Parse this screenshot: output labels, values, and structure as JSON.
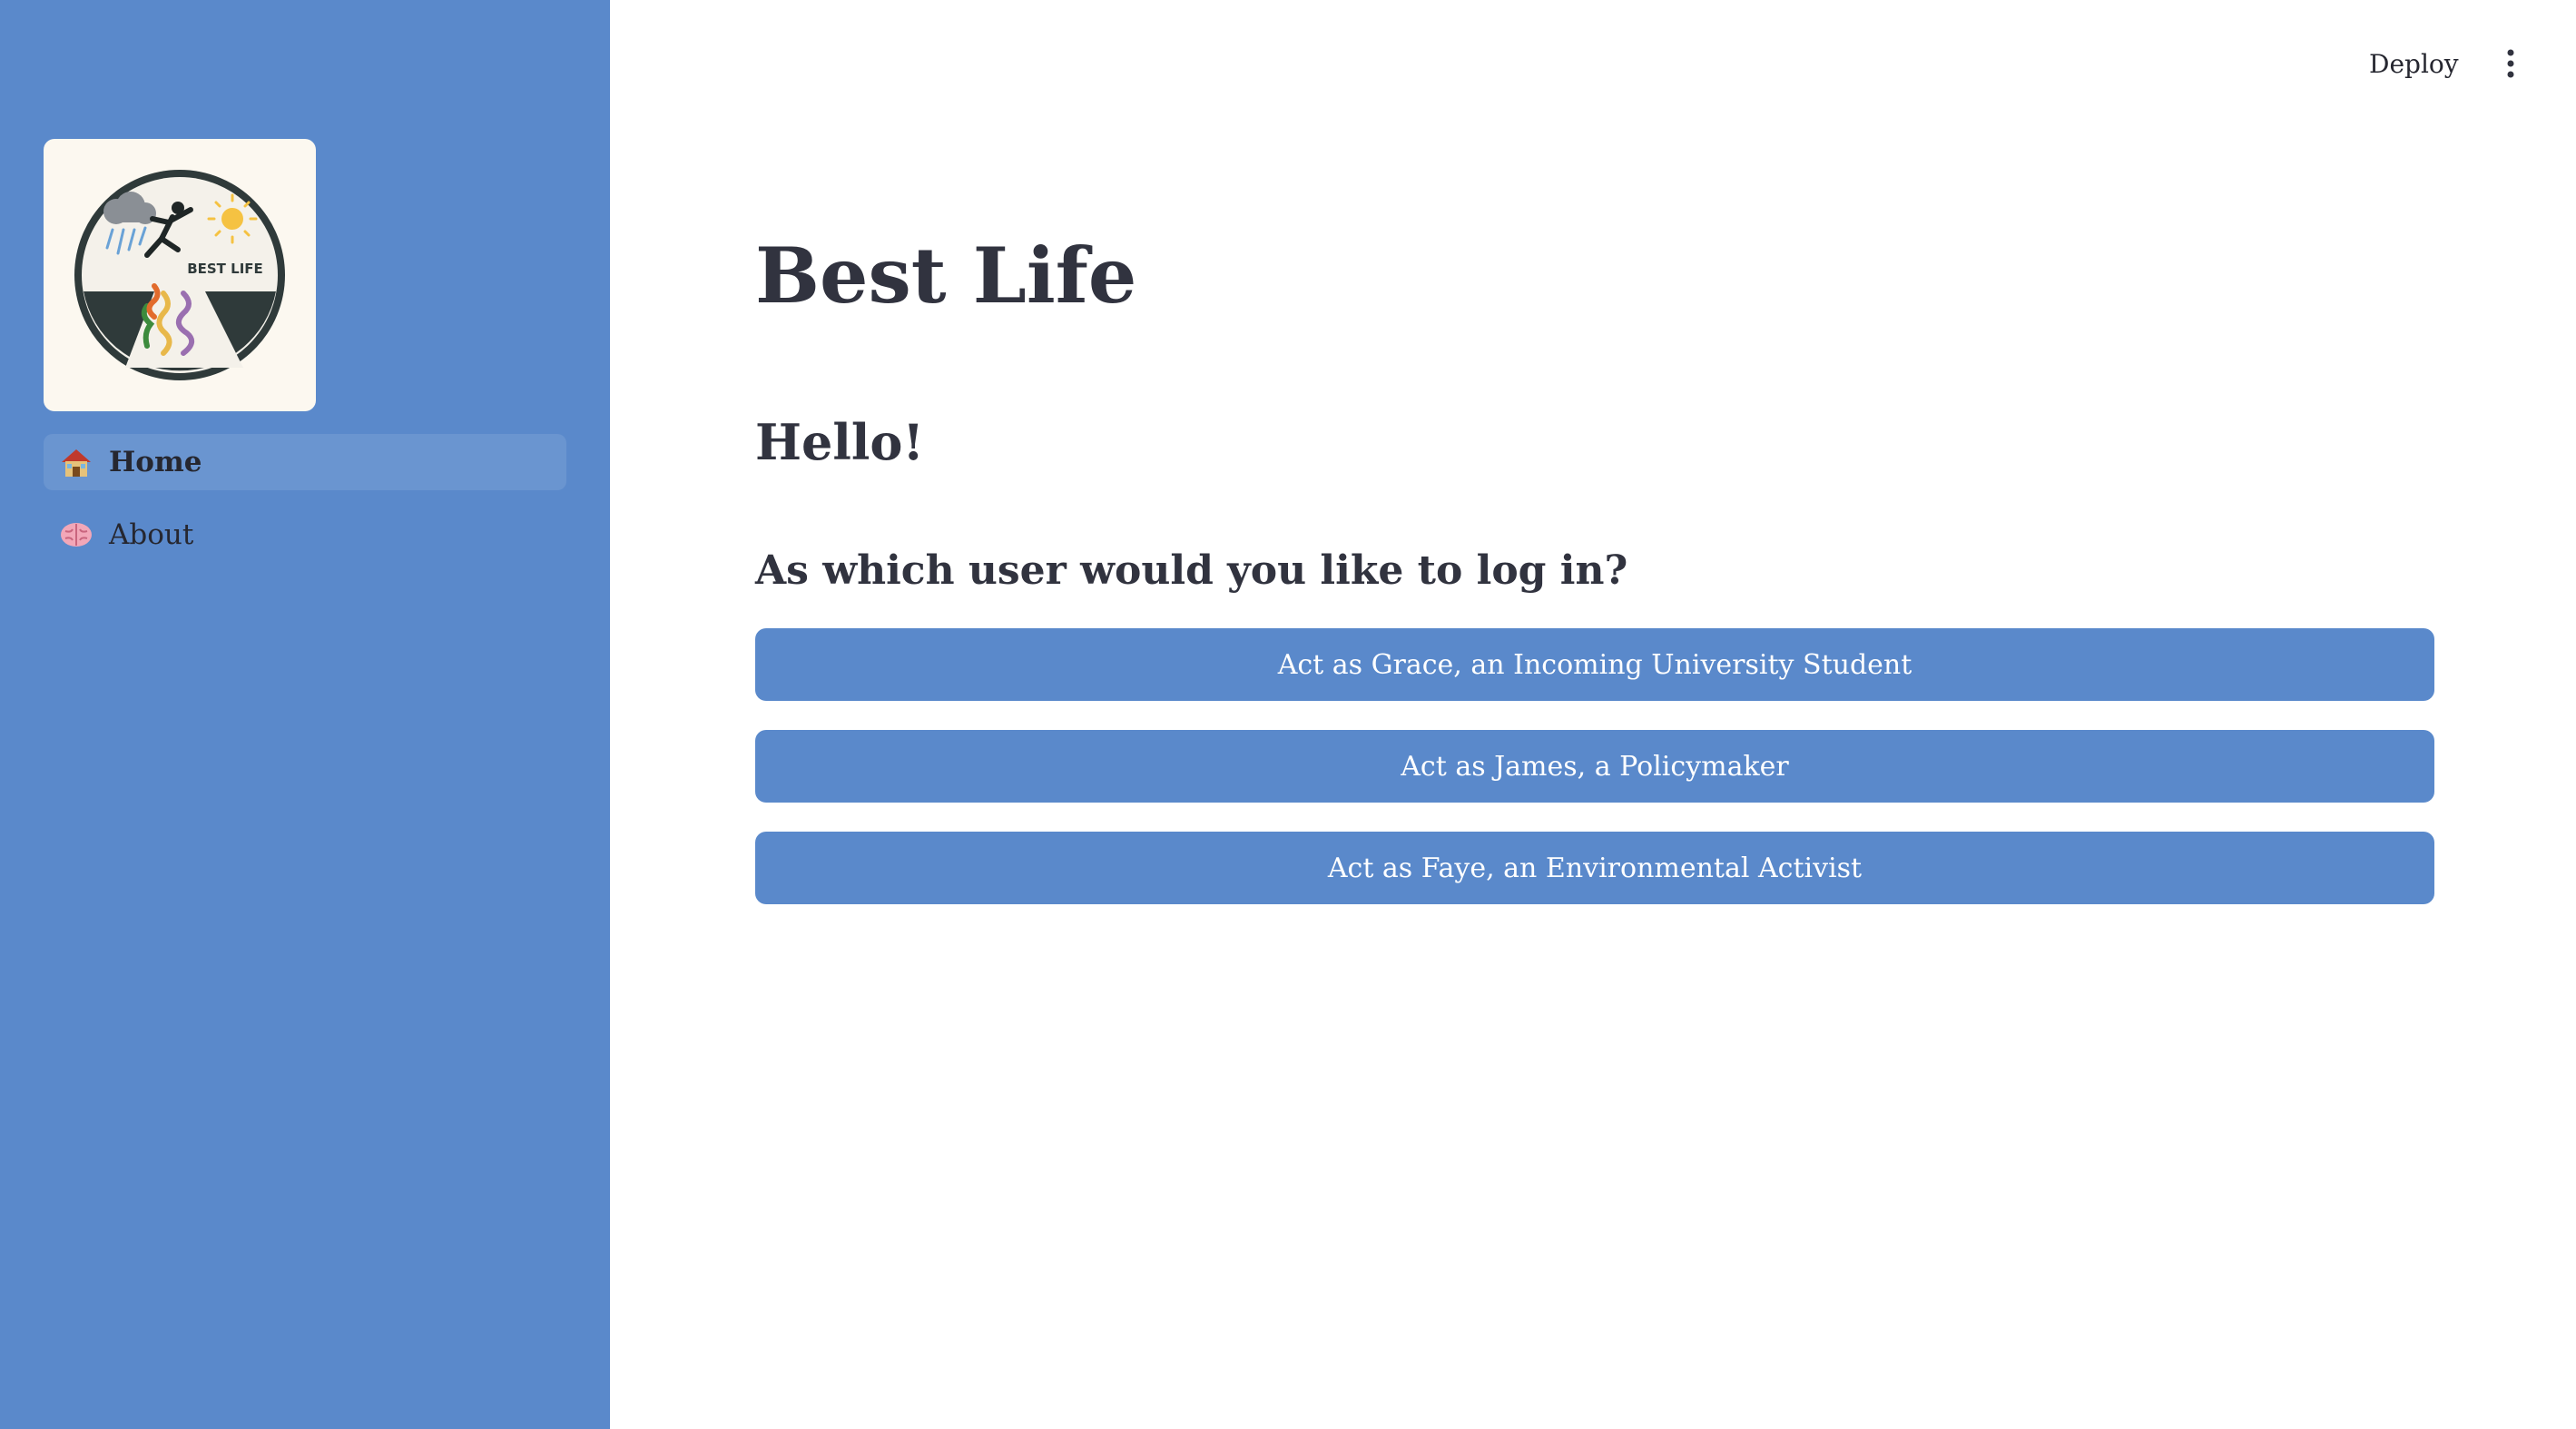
{
  "sidebar": {
    "logo": {
      "text": "BEST LIFE"
    },
    "nav": [
      {
        "label": "Home",
        "icon": "house-icon",
        "active": true
      },
      {
        "label": "About",
        "icon": "brain-icon",
        "active": false
      }
    ]
  },
  "header": {
    "deploy_label": "Deploy",
    "menu_icon": "vertical-ellipsis-icon"
  },
  "main": {
    "title": "Best Life",
    "greeting": "Hello!",
    "question": "As which user would you like to log in?",
    "buttons": [
      {
        "label": "Act as Grace, an Incoming University Student"
      },
      {
        "label": "Act as James, a Policymaker"
      },
      {
        "label": "Act as Faye, an Environmental Activist"
      }
    ]
  },
  "colors": {
    "sidebar_bg": "#5a89cb",
    "button_bg": "#5a89cb",
    "text": "#31333f",
    "logo_bg": "#fcf8f0"
  }
}
